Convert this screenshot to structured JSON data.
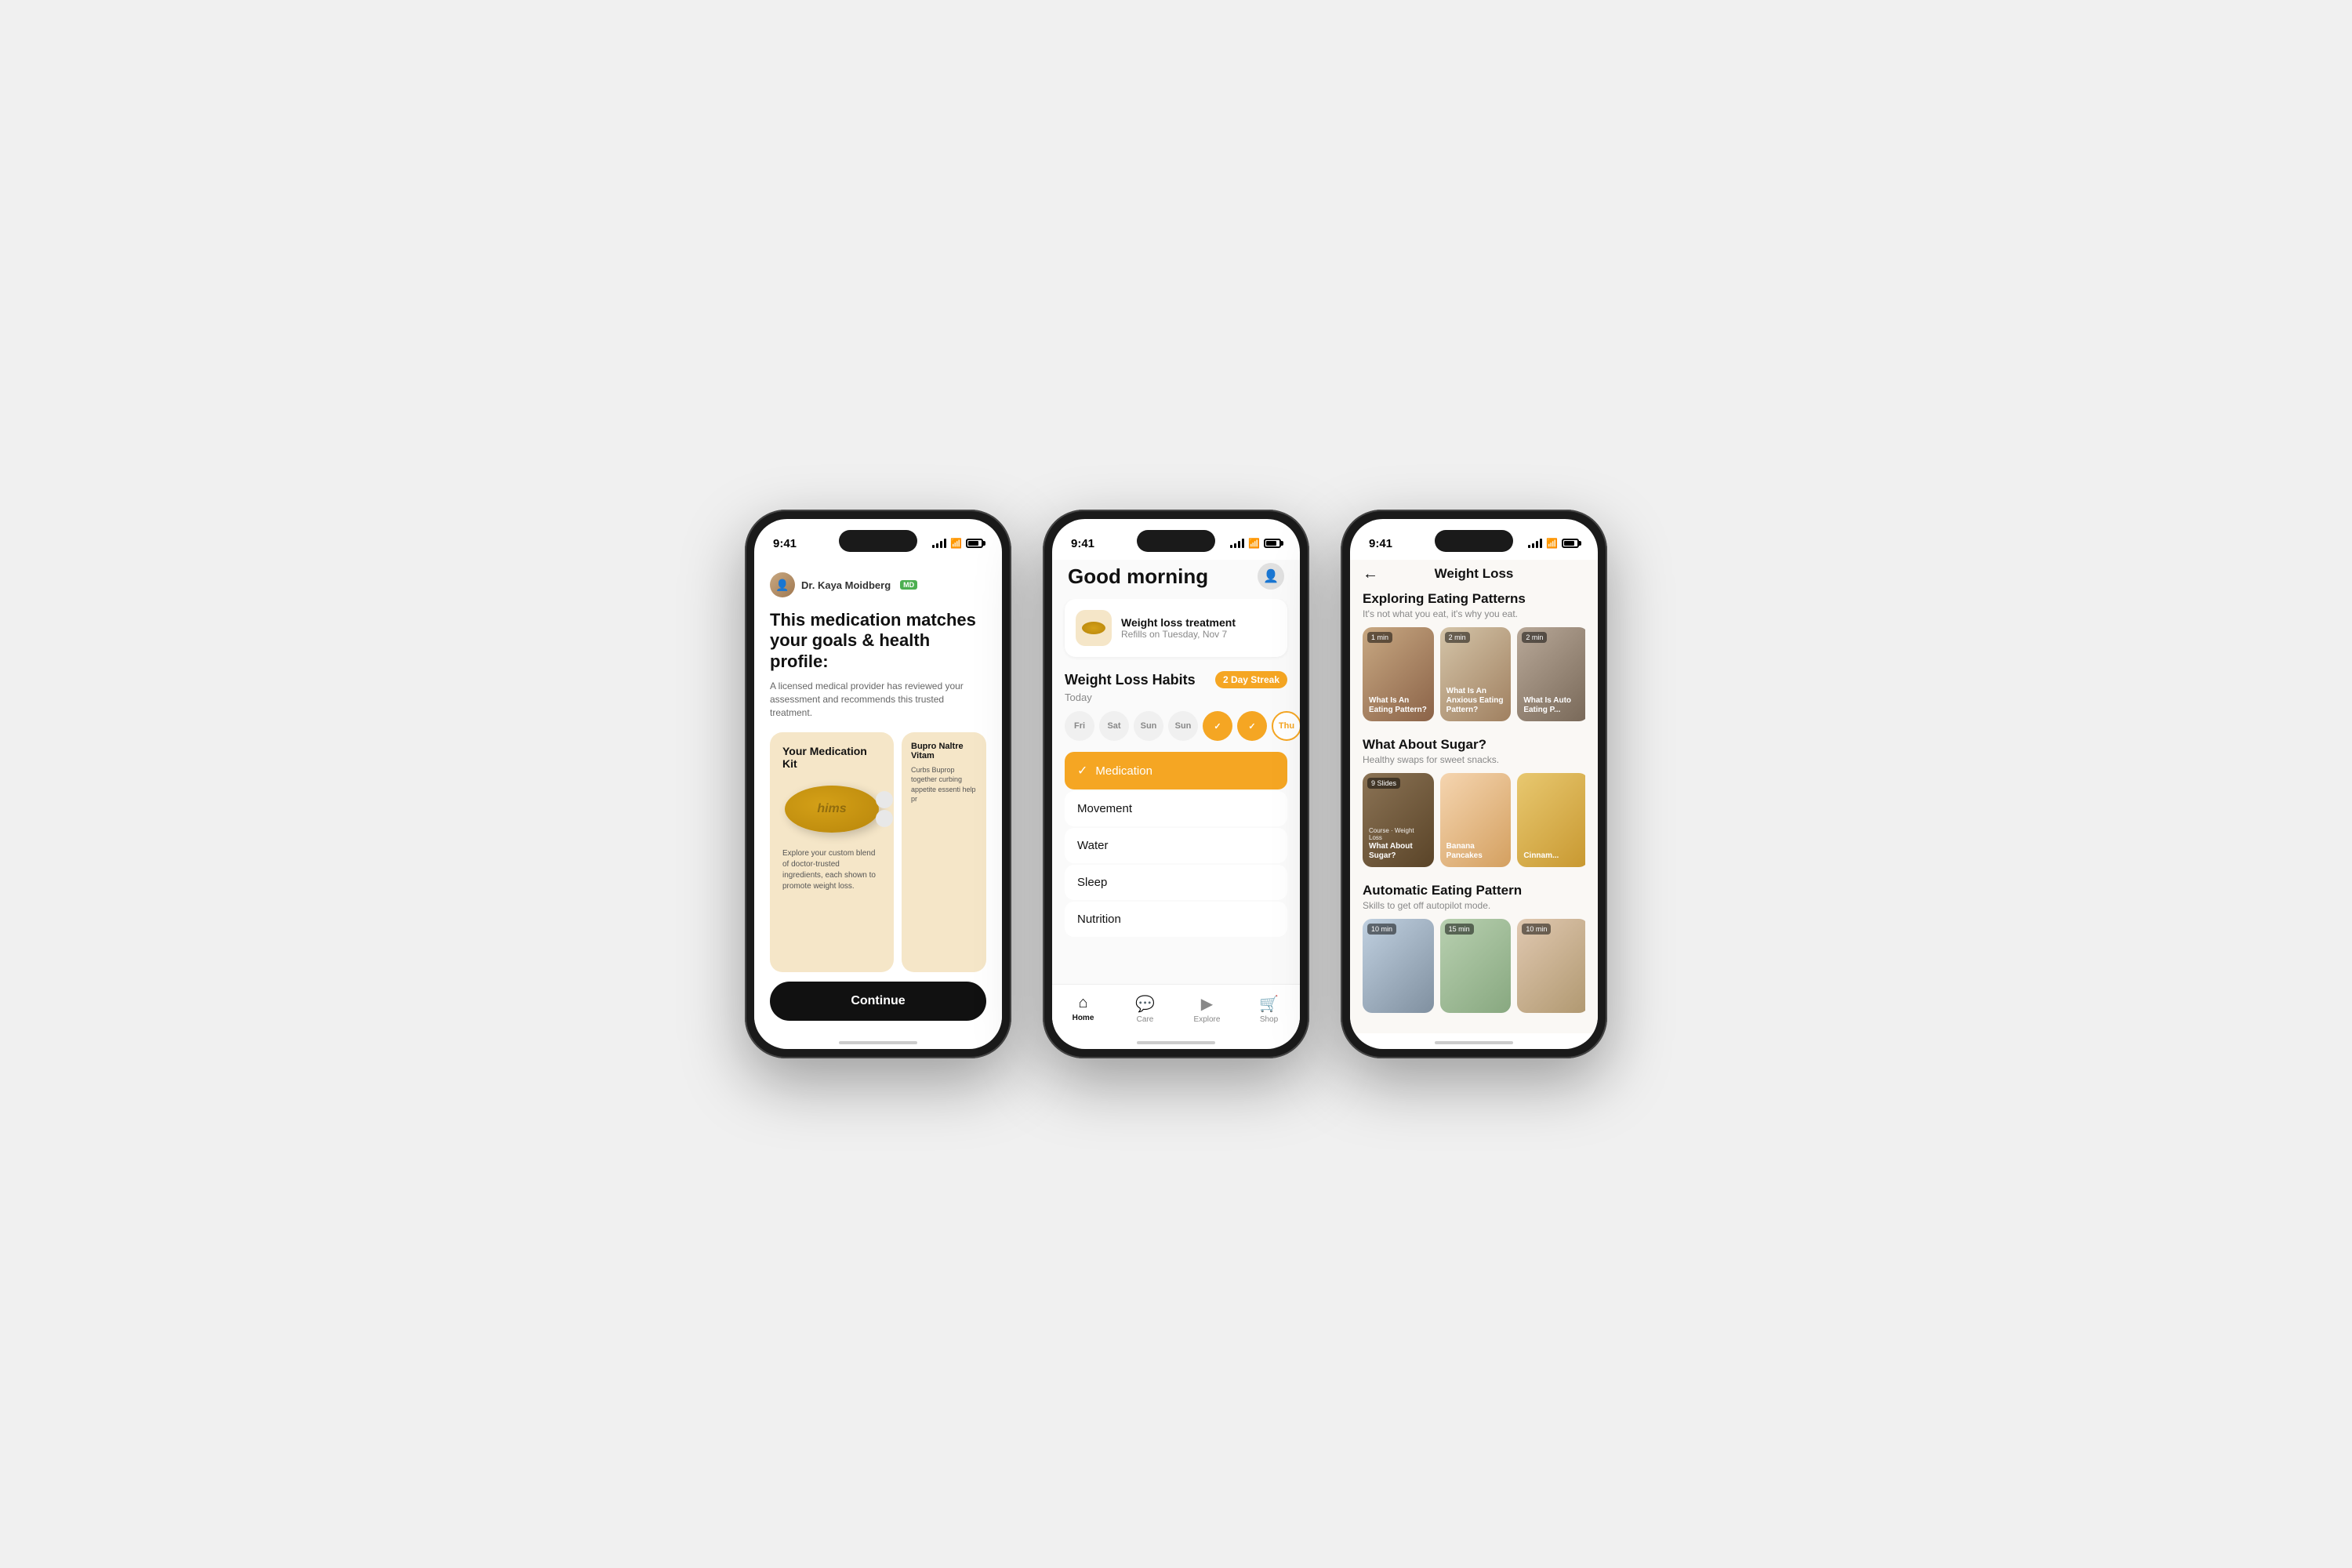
{
  "phone1": {
    "status_time": "9:41",
    "doctor_name": "Dr. Kaya Moidberg",
    "md_badge": "MD",
    "headline": "This medication matches your goals & health profile:",
    "subtext": "A licensed medical provider has reviewed your assessment and recommends this trusted treatment.",
    "med_kit_title": "Your Medication Kit",
    "med_kit_desc": "Explore your custom blend of doctor-trusted ingredients, each shown to promote weight loss.",
    "side_title": "Bupro Naltre Vitam",
    "side_desc": "Curbs Buprop together curbing appetite essenti help pr",
    "continue_label": "Continue"
  },
  "phone2": {
    "status_time": "9:41",
    "greeting": "Good morning",
    "refill_title": "Weight loss treatment",
    "refill_sub": "Refills on Tuesday, Nov 7",
    "habits_title": "Weight Loss Habits",
    "habits_today": "Today",
    "streak_label": "2 Day Streak",
    "days": [
      "Fri",
      "Sat",
      "Sun",
      "Sun",
      "✓",
      "✓",
      "Thu"
    ],
    "day_states": [
      "normal",
      "normal",
      "normal",
      "normal",
      "checked",
      "checked",
      "active"
    ],
    "habits": [
      {
        "label": "Medication",
        "completed": true
      },
      {
        "label": "Movement",
        "completed": false
      },
      {
        "label": "Water",
        "completed": false
      },
      {
        "label": "Sleep",
        "completed": false
      },
      {
        "label": "Nutrition",
        "completed": false
      }
    ],
    "nav_items": [
      {
        "label": "Home",
        "icon": "🏠",
        "active": true
      },
      {
        "label": "Care",
        "icon": "💬",
        "active": false
      },
      {
        "label": "Explore",
        "icon": "▶",
        "active": false
      },
      {
        "label": "Shop",
        "icon": "🛒",
        "active": false
      }
    ]
  },
  "phone3": {
    "status_time": "9:41",
    "page_title": "Weight Loss",
    "section1_title": "Exploring Eating Patterns",
    "section1_sub": "It's not what you eat, it's why you eat.",
    "section2_title": "What About Sugar?",
    "section2_sub": "Healthy swaps for sweet snacks.",
    "section3_title": "Automatic Eating Pattern",
    "section3_sub": "Skills to get off autopilot mode.",
    "cards_section1": [
      {
        "duration": "1 min",
        "label": "What Is An Eating Pattern?"
      },
      {
        "duration": "2 min",
        "label": "What Is An Anxious Eating Pattern?"
      },
      {
        "duration": "2 min",
        "label": "What Is Auto Eating P..."
      }
    ],
    "cards_section2": [
      {
        "duration": "9 Slides",
        "sublabel": "Course · Weight Loss",
        "label": "What About Sugar?"
      },
      {
        "label": "Banana Pancakes"
      },
      {
        "label": "Cinnam..."
      }
    ],
    "cards_section3": [
      {
        "duration": "10 min",
        "label": ""
      },
      {
        "duration": "15 min",
        "label": ""
      },
      {
        "duration": "10 min",
        "label": ""
      }
    ]
  }
}
